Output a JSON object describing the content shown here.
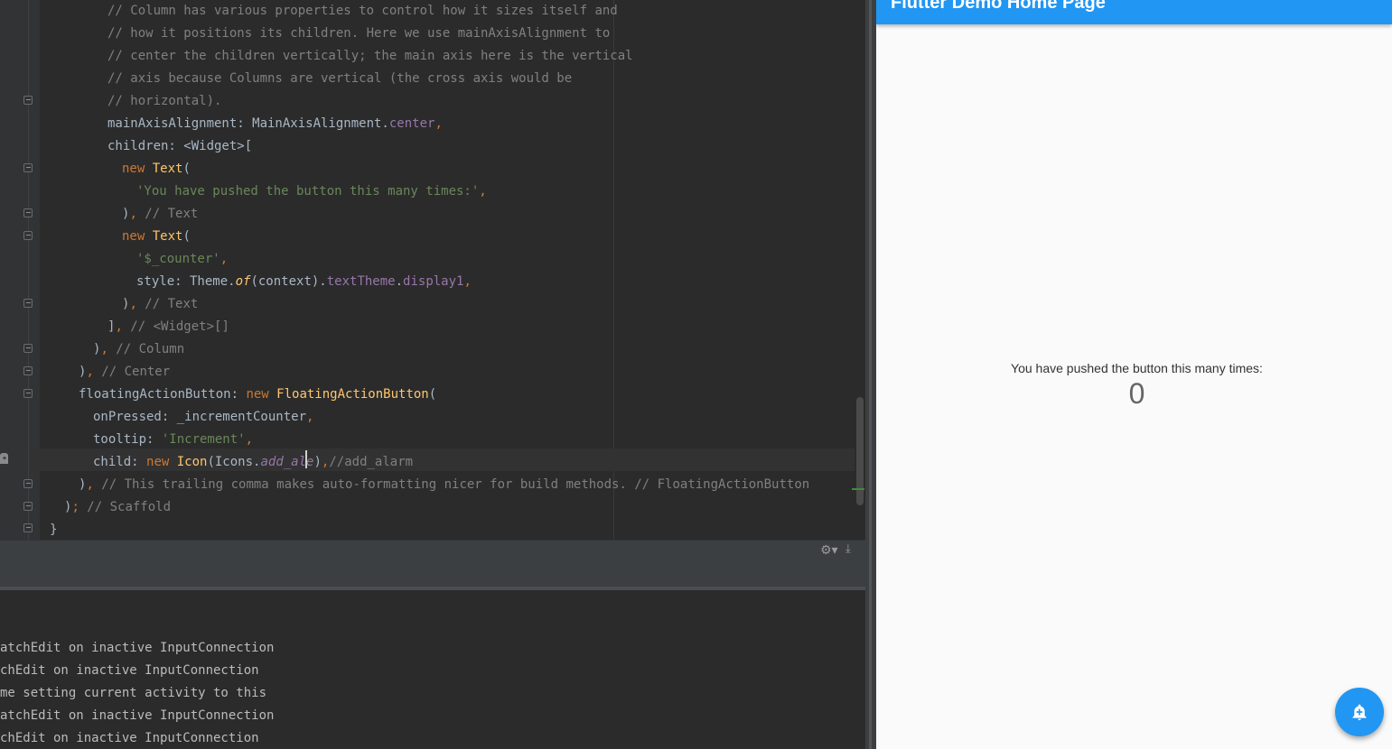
{
  "editor": {
    "lines": [
      {
        "indent": 119,
        "parts": [
          {
            "t": "// Column has various properties to control how it sizes itself and",
            "c": "cm"
          }
        ]
      },
      {
        "indent": 119,
        "parts": [
          {
            "t": "// how it positions its children. Here we use mainAxisAlignment to",
            "c": "cm"
          }
        ]
      },
      {
        "indent": 119,
        "parts": [
          {
            "t": "// center the children vertically; the main axis here is the vertical",
            "c": "cm"
          }
        ]
      },
      {
        "indent": 119,
        "parts": [
          {
            "t": "// axis because Columns are vertical (the cross axis would be",
            "c": "cm"
          }
        ]
      },
      {
        "indent": 119,
        "parts": [
          {
            "t": "// horizontal).",
            "c": "cm"
          }
        ]
      },
      {
        "indent": 119,
        "parts": [
          {
            "t": "mainAxisAlignment: MainAxisAlignment.",
            "c": ""
          },
          {
            "t": "center",
            "c": "fld"
          },
          {
            "t": ",",
            "c": "kw"
          }
        ]
      },
      {
        "indent": 119,
        "parts": [
          {
            "t": "children: <Widget>[",
            "c": ""
          }
        ]
      },
      {
        "indent": 135,
        "parts": [
          {
            "t": "new ",
            "c": "kw"
          },
          {
            "t": "Text",
            "c": "fn"
          },
          {
            "t": "(",
            "c": ""
          }
        ]
      },
      {
        "indent": 151,
        "parts": [
          {
            "t": "'You have pushed the button this many times:'",
            "c": "str"
          },
          {
            "t": ",",
            "c": "kw"
          }
        ]
      },
      {
        "indent": 135,
        "parts": [
          {
            "t": ")",
            "c": ""
          },
          {
            "t": ",",
            "c": "kw"
          },
          {
            "t": " // Text",
            "c": "cm"
          }
        ]
      },
      {
        "indent": 135,
        "parts": [
          {
            "t": "new ",
            "c": "kw"
          },
          {
            "t": "Text",
            "c": "fn"
          },
          {
            "t": "(",
            "c": ""
          }
        ]
      },
      {
        "indent": 151,
        "parts": [
          {
            "t": "'$_counter'",
            "c": "str"
          },
          {
            "t": ",",
            "c": "kw"
          }
        ]
      },
      {
        "indent": 151,
        "parts": [
          {
            "t": "style: Theme.",
            "c": ""
          },
          {
            "t": "of",
            "c": "fn it"
          },
          {
            "t": "(context).",
            "c": ""
          },
          {
            "t": "textTheme",
            "c": "fld"
          },
          {
            "t": ".",
            "c": ""
          },
          {
            "t": "display1",
            "c": "fld"
          },
          {
            "t": ",",
            "c": "kw"
          }
        ]
      },
      {
        "indent": 135,
        "parts": [
          {
            "t": ")",
            "c": ""
          },
          {
            "t": ",",
            "c": "kw"
          },
          {
            "t": " // Text",
            "c": "cm"
          }
        ]
      },
      {
        "indent": 119,
        "parts": [
          {
            "t": "]",
            "c": ""
          },
          {
            "t": ",",
            "c": "kw"
          },
          {
            "t": " // <Widget>[]",
            "c": "cm"
          }
        ]
      },
      {
        "indent": 103,
        "parts": [
          {
            "t": ")",
            "c": ""
          },
          {
            "t": ",",
            "c": "kw"
          },
          {
            "t": " // Column",
            "c": "cm"
          }
        ]
      },
      {
        "indent": 87,
        "parts": [
          {
            "t": ")",
            "c": ""
          },
          {
            "t": ",",
            "c": "kw"
          },
          {
            "t": " // Center",
            "c": "cm"
          }
        ]
      },
      {
        "indent": 87,
        "parts": [
          {
            "t": "floatingActionButton: ",
            "c": ""
          },
          {
            "t": "new ",
            "c": "kw"
          },
          {
            "t": "FloatingActionButton",
            "c": "fn"
          },
          {
            "t": "(",
            "c": ""
          }
        ]
      },
      {
        "indent": 103,
        "parts": [
          {
            "t": "onPressed: _incrementCounter",
            "c": ""
          },
          {
            "t": ",",
            "c": "kw"
          }
        ]
      },
      {
        "indent": 103,
        "parts": [
          {
            "t": "tooltip: ",
            "c": ""
          },
          {
            "t": "'Increment'",
            "c": "str"
          },
          {
            "t": ",",
            "c": "kw"
          }
        ]
      },
      {
        "indent": 103,
        "parts": [
          {
            "t": "child: ",
            "c": ""
          },
          {
            "t": "new ",
            "c": "kw"
          },
          {
            "t": "Icon",
            "c": "fn"
          },
          {
            "t": "(Icons.",
            "c": ""
          },
          {
            "t": "add_ale",
            "c": "fld it"
          },
          {
            "t": ")",
            "c": ""
          },
          {
            "t": ",",
            "c": "kw"
          },
          {
            "t": "//add_alarm",
            "c": "cm"
          }
        ]
      },
      {
        "indent": 87,
        "parts": [
          {
            "t": ")",
            "c": ""
          },
          {
            "t": ",",
            "c": "kw"
          },
          {
            "t": " // This trailing comma makes auto-formatting nicer for build methods. // FloatingActionButton",
            "c": "cm"
          }
        ]
      },
      {
        "indent": 71,
        "parts": [
          {
            "t": ")",
            "c": ""
          },
          {
            "t": ";",
            "c": "kw"
          },
          {
            "t": " // Scaffold",
            "c": "cm"
          }
        ]
      },
      {
        "indent": 55,
        "parts": [
          {
            "t": "}",
            "c": ""
          }
        ]
      }
    ]
  },
  "console": {
    "lines": [
      "atchEdit on inactive InputConnection",
      "chEdit on inactive InputConnection",
      "me setting current activity to this",
      "atchEdit on inactive InputConnection",
      "chEdit on inactive InputConnection"
    ]
  },
  "app": {
    "title": "Flutter Demo Home Page",
    "message": "You have pushed the button this many times:",
    "counter": "0",
    "fab_icon": "add-alert-icon"
  },
  "colors": {
    "app_bar": "#2196f3",
    "editor_bg": "#2b2b2b",
    "keyword": "#cc7832",
    "string": "#6a8759",
    "comment": "#808080"
  }
}
